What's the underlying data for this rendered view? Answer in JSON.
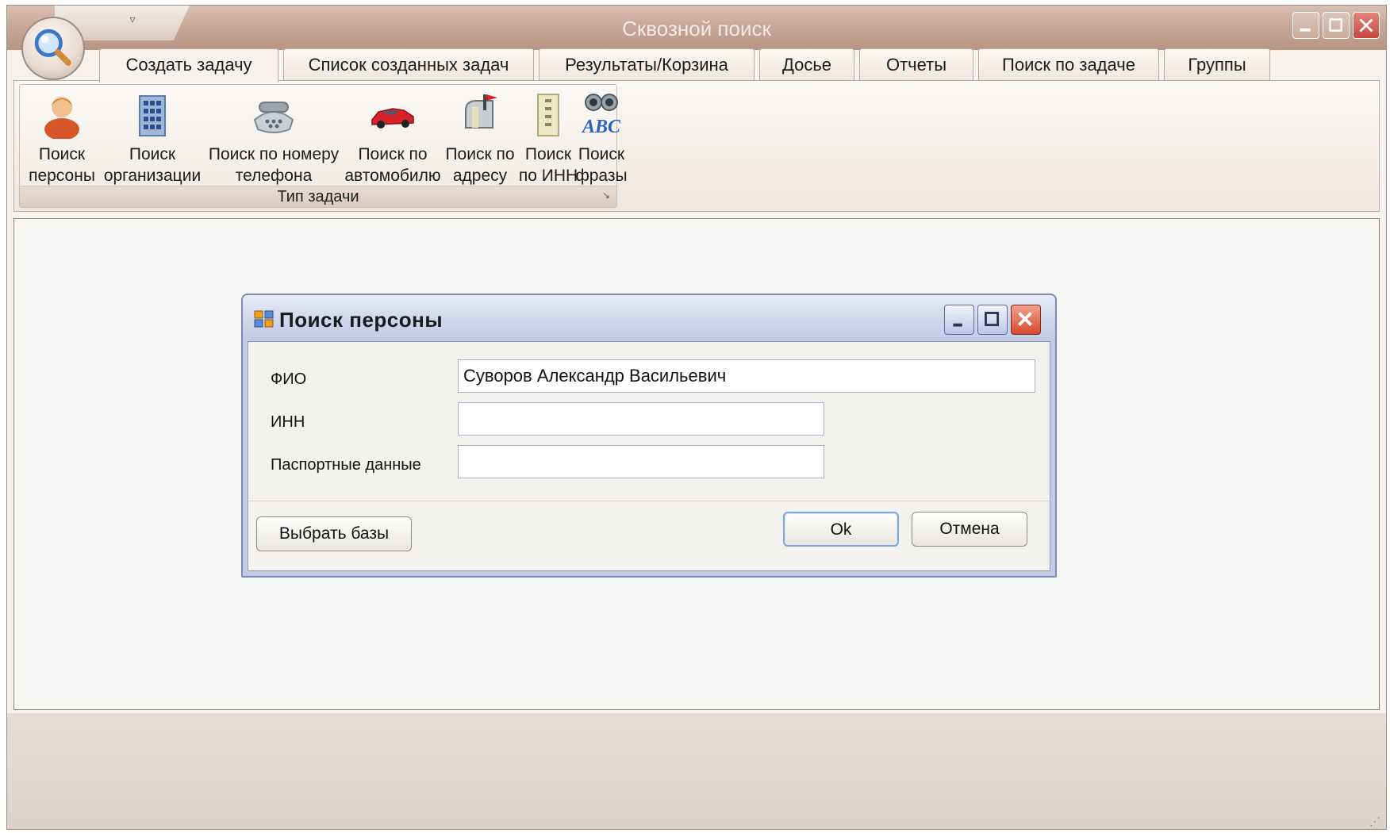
{
  "app": {
    "title": "Сквозной поиск",
    "qat_dropdown": "▿",
    "window_controls": [
      "minimize-icon",
      "maximize-icon",
      "close-icon"
    ]
  },
  "tabs": [
    {
      "label": "Создать задачу",
      "active": true
    },
    {
      "label": "Список созданных задач",
      "active": false
    },
    {
      "label": "Результаты/Корзина",
      "active": false
    },
    {
      "label": "Досье",
      "active": false
    },
    {
      "label": "Отчеты",
      "active": false
    },
    {
      "label": "Поиск по задаче",
      "active": false
    },
    {
      "label": "Группы",
      "active": false
    }
  ],
  "ribbon": {
    "group_caption": "Тип задачи",
    "group_launcher": "↘",
    "buttons": [
      {
        "label": "Поиск\nперсоны",
        "icon": "person-icon"
      },
      {
        "label": "Поиск\nорганизации",
        "icon": "building-icon"
      },
      {
        "label": "Поиск по номеру\nтелефона",
        "icon": "phone-icon"
      },
      {
        "label": "Поиск по\nавтомобилю",
        "icon": "car-icon"
      },
      {
        "label": "Поиск по\nадресу",
        "icon": "mailbox-icon"
      },
      {
        "label": "Поиск\nпо ИНН",
        "icon": "document-scroll-icon"
      },
      {
        "label": "Поиск\nфразы",
        "icon": "binoculars-abc-icon"
      }
    ]
  },
  "dialog": {
    "title": "Поиск персоны",
    "fields": [
      {
        "label": "ФИО",
        "value": "Суворов Александр Васильевич"
      },
      {
        "label": "ИНН",
        "value": ""
      },
      {
        "label": "Паспортные данные",
        "value": ""
      }
    ],
    "buttons": {
      "select_bases": "Выбрать базы",
      "ok": "Ok",
      "cancel": "Отмена"
    }
  },
  "colors": {
    "title_bar": "#c7a898",
    "window_bg": "#f7f2ed",
    "dialog_title": "#d2d8ec",
    "close_button": "#c5473d"
  },
  "status_bar": {
    "grip": "⋰"
  }
}
